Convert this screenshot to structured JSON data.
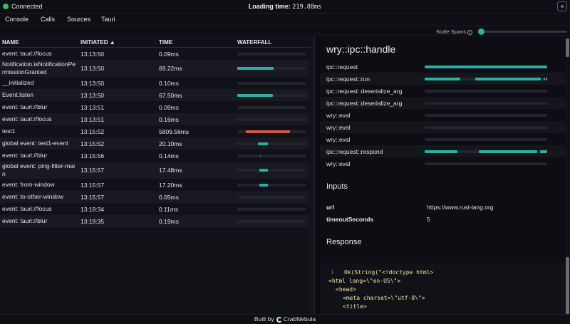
{
  "status": {
    "label": "Connected",
    "color": "#2fc062"
  },
  "loading": {
    "label": "Loading time:",
    "value": "219.88ms"
  },
  "close_label": "×",
  "tabs": [
    "Console",
    "Calls",
    "Sources",
    "Tauri"
  ],
  "scale": {
    "label": "Scale Spans",
    "info": "i",
    "value_fraction": 0
  },
  "table": {
    "headers": {
      "name": "NAME",
      "initiated": "INITIATED ▲",
      "time": "TIME",
      "waterfall": "WATERFALL"
    },
    "rows": [
      {
        "name": "event: tauri://focus",
        "initiated": "13:13:50",
        "time": "0.09ms",
        "wf": [
          0,
          0,
          "#2bb1a3"
        ]
      },
      {
        "name": "Notification.isNotificationPermissionGranted",
        "initiated": "13:13:50",
        "time": "69.22ms",
        "wf": [
          0,
          0.53,
          "#2bb1a3"
        ]
      },
      {
        "name": "__initialized",
        "initiated": "13:13:50",
        "time": "0.10ms",
        "wf": [
          0,
          0,
          "#2bb1a3"
        ]
      },
      {
        "name": "Event.listen",
        "initiated": "13:13:50",
        "time": "67.50ms",
        "wf": [
          0,
          0.52,
          "#2bb1a3"
        ]
      },
      {
        "name": "event: tauri://blur",
        "initiated": "13:13:51",
        "time": "0.09ms",
        "wf": [
          0,
          0,
          "#2bb1a3"
        ]
      },
      {
        "name": "event: tauri://focus",
        "initiated": "13:13:51",
        "time": "0.16ms",
        "wf": [
          0,
          0,
          "#2bb1a3"
        ]
      },
      {
        "name": "test1",
        "initiated": "13:15:52",
        "time": "5809.56ms",
        "wf": [
          0.125,
          0.77,
          "#d9534f"
        ]
      },
      {
        "name": "global event: test1-event",
        "initiated": "13:15:52",
        "time": "20.10ms",
        "wf": [
          0.3,
          0.45,
          "#2bb1a3"
        ]
      },
      {
        "name": "event: tauri://blur",
        "initiated": "13:15:56",
        "time": "0.14ms",
        "wf": [
          0.33,
          0.34,
          "#5a5a66"
        ]
      },
      {
        "name": "global event: ping-filter-main",
        "initiated": "13:15:57",
        "time": "17.48ms",
        "wf": [
          0.32,
          0.45,
          "#2bb1a3"
        ]
      },
      {
        "name": "event: from-window",
        "initiated": "13:15:57",
        "time": "17.20ms",
        "wf": [
          0.32,
          0.45,
          "#2bb1a3"
        ]
      },
      {
        "name": "event: to-other-window",
        "initiated": "13:15:57",
        "time": "0.05ms",
        "wf": [
          0,
          0,
          "#2bb1a3"
        ]
      },
      {
        "name": "event: tauri://focus",
        "initiated": "13:19:34",
        "time": "0.11ms",
        "wf": [
          0,
          0,
          "#2bb1a3"
        ]
      },
      {
        "name": "event: tauri://blur",
        "initiated": "13:19:35",
        "time": "0.19ms",
        "wf": [
          0,
          0,
          "#2bb1a3"
        ]
      }
    ]
  },
  "detail": {
    "title": "wry::ipc::handle",
    "spans": [
      {
        "label": "ipc::request",
        "segments": [
          [
            0,
            1
          ]
        ]
      },
      {
        "label": "ipc::request::run",
        "segments": [
          [
            0,
            0.29
          ],
          [
            0.41,
            0.95
          ],
          [
            0.97,
            0.98
          ],
          [
            0.99,
            1
          ]
        ]
      },
      {
        "label": "ipc::request::deserialize_arg",
        "segments": []
      },
      {
        "label": "ipc::request::deserialize_arg",
        "segments": []
      },
      {
        "label": "wry::eval",
        "segments": []
      },
      {
        "label": "wry::eval",
        "segments": []
      },
      {
        "label": "wry::eval",
        "segments": []
      },
      {
        "label": "ipc::request::respond",
        "segments": [
          [
            0,
            0.27
          ],
          [
            0.44,
            0.92
          ],
          [
            0.94,
            1
          ]
        ]
      },
      {
        "label": "wry::eval",
        "segments": []
      }
    ],
    "inputs_title": "Inputs",
    "inputs": [
      {
        "key": "url",
        "value": "https://www.rust-lang.org"
      },
      {
        "key": "timeoutSeconds",
        "value": "5"
      }
    ],
    "response_title": "Response",
    "code_lines": [
      {
        "no": "1",
        "text": "Ok(String(\"<!doctype html>",
        "indent": 1
      },
      {
        "no": "",
        "text": "<html lang=\\\"en-US\\\">",
        "indent": 0
      },
      {
        "no": "",
        "text": "<head>",
        "indent": 1
      },
      {
        "no": "",
        "text": "<meta charset=\\\"utf-8\\\">",
        "indent": 2
      },
      {
        "no": "",
        "text": "<title>",
        "indent": 2
      }
    ]
  },
  "footer": {
    "prefix": "Built by",
    "brand": "CrabNebula"
  }
}
